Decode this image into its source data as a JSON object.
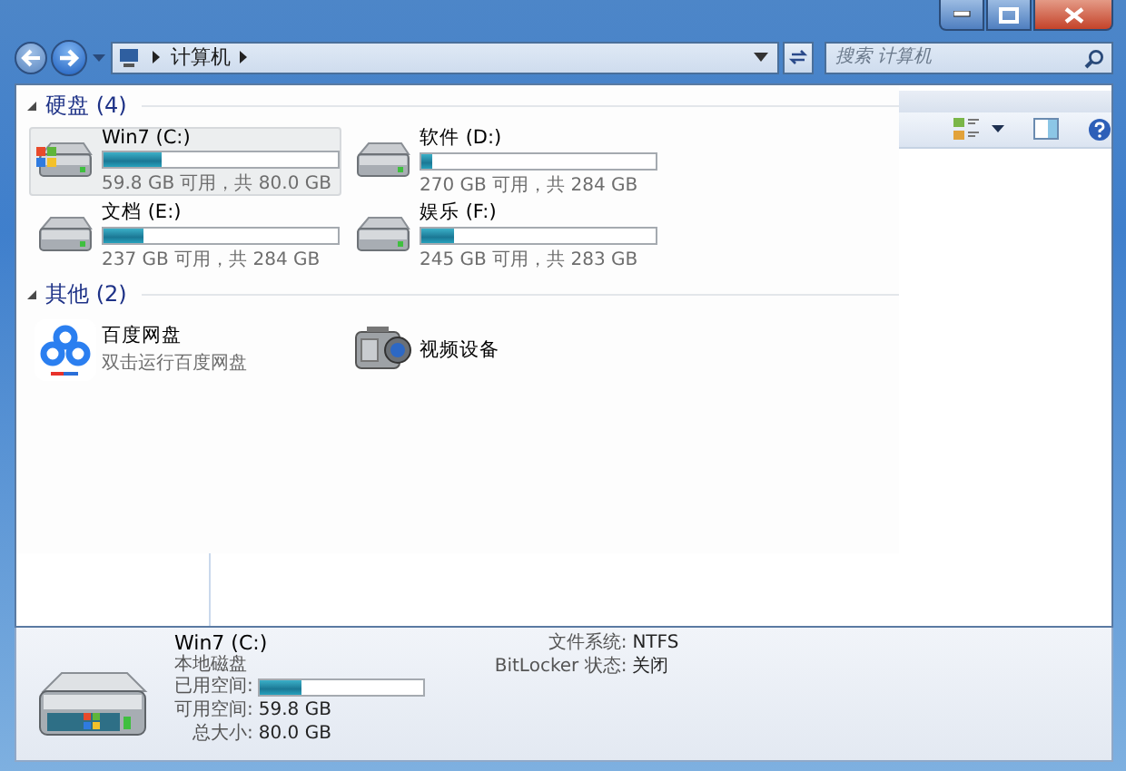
{
  "address_bar": {
    "breadcrumb": [
      "计算机"
    ]
  },
  "search": {
    "placeholder": "搜索 计算机"
  },
  "groups": [
    {
      "title": "硬盘 (4)",
      "expanded": true,
      "items": [
        {
          "kind": "drive",
          "name": "Win7 (C:)",
          "system": true,
          "selected": true,
          "level": 0.25,
          "caption": "59.8 GB 可用，共 80.0 GB"
        },
        {
          "kind": "drive",
          "name": "软件 (D:)",
          "system": false,
          "selected": false,
          "level": 0.05,
          "caption": "270 GB 可用，共 284 GB"
        },
        {
          "kind": "drive",
          "name": "文档 (E:)",
          "system": false,
          "selected": false,
          "level": 0.17,
          "caption": "237 GB 可用，共 284 GB"
        },
        {
          "kind": "drive",
          "name": "娱乐 (F:)",
          "system": false,
          "selected": false,
          "level": 0.14,
          "caption": "245 GB 可用，共 283 GB"
        }
      ]
    },
    {
      "title": "其他 (2)",
      "expanded": true,
      "items": [
        {
          "kind": "cloud-app",
          "name": "百度网盘",
          "caption": "双击运行百度网盘",
          "selected": false
        },
        {
          "kind": "camera",
          "name": "视频设备",
          "selected": false
        }
      ]
    }
  ],
  "details": {
    "name": "Win7 (C:)",
    "type": "本地磁盘",
    "used_label": "已用空间:",
    "level": 0.25,
    "rows": [
      {
        "label": "可用空间:",
        "value": "59.8 GB"
      },
      {
        "label": "总大小:",
        "value": "80.0 GB"
      }
    ],
    "props": [
      {
        "label": "文件系统:",
        "value": "NTFS"
      },
      {
        "label": "BitLocker 状态:",
        "value": "关闭"
      }
    ]
  }
}
